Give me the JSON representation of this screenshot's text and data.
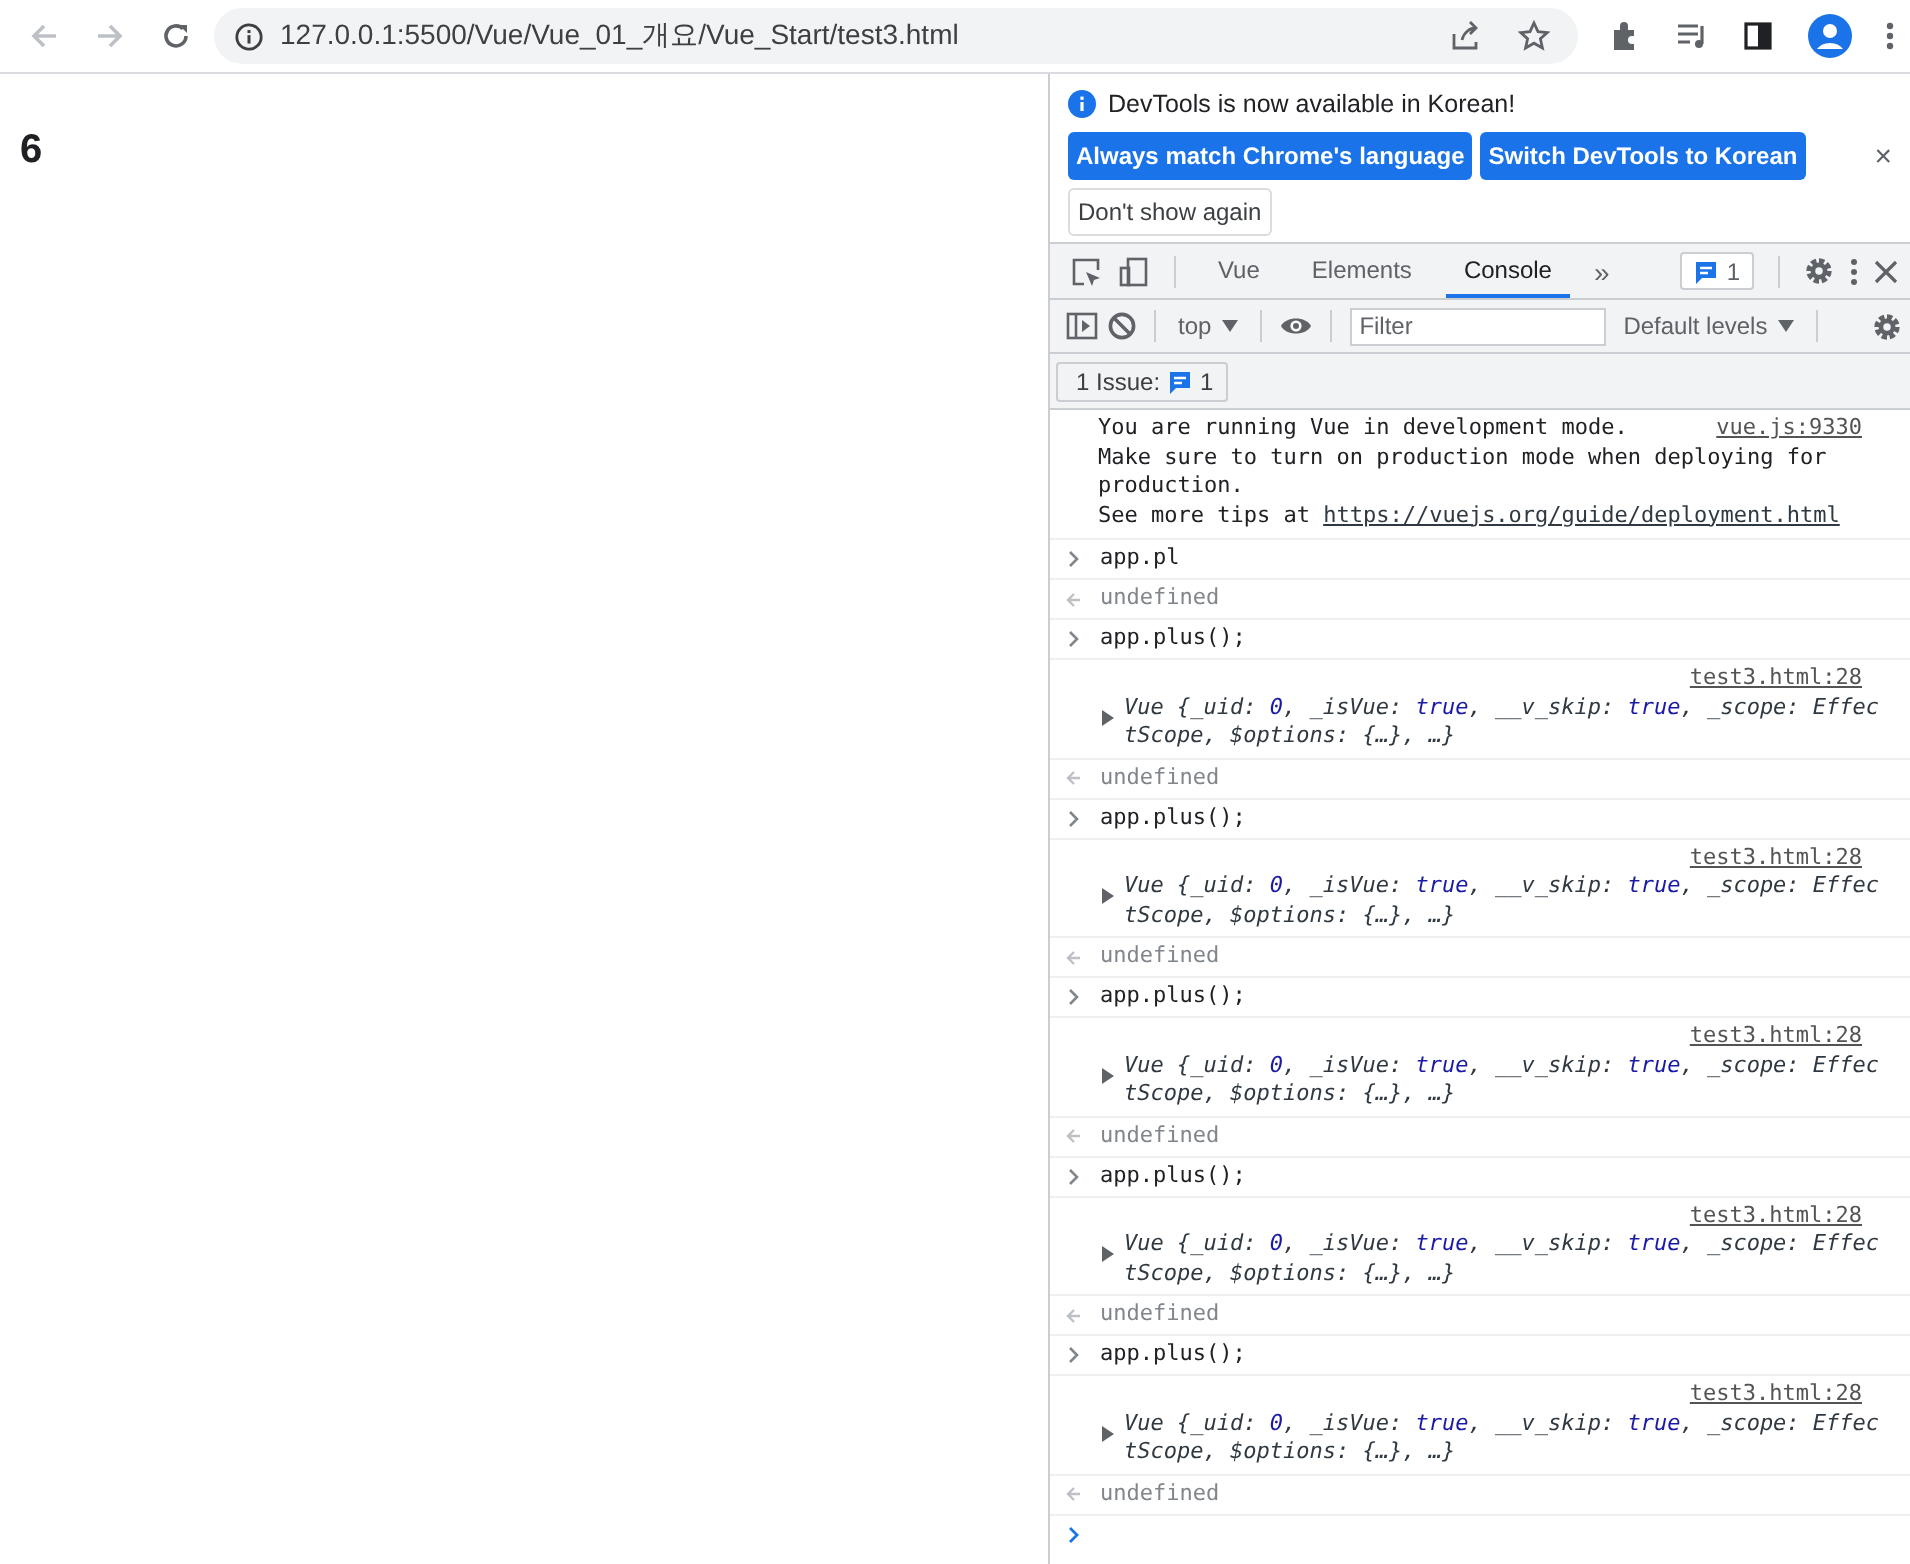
{
  "browser": {
    "url": "127.0.0.1:5500/Vue/Vue_01_개요/Vue_Start/test3.html"
  },
  "page": {
    "heading": "6"
  },
  "devtools": {
    "infobar": {
      "message": "DevTools is now available in Korean!",
      "close": "×",
      "buttons": [
        {
          "label": "Always match Chrome's language",
          "kind": "primary"
        },
        {
          "label": "Switch DevTools to Korean",
          "kind": "primary"
        },
        {
          "label": "Don't show again",
          "kind": "secondary"
        }
      ]
    },
    "tabs": [
      {
        "label": "Vue",
        "selected": false
      },
      {
        "label": "Elements",
        "selected": false
      },
      {
        "label": "Console",
        "selected": true
      }
    ],
    "more": "»",
    "issues_count": "1",
    "console_toolbar": {
      "context": "top",
      "filter_placeholder": "Filter",
      "levels": "Default levels"
    },
    "issues_button": {
      "label": "1 Issue:",
      "count": "1"
    },
    "entries": [
      {
        "kind": "log",
        "source": "vue.js:9330",
        "lines": [
          "You are running Vue in development mode.",
          "Make sure to turn on production mode when deploying for production."
        ],
        "tip": "See more tips at",
        "link": "https://vuejs.org/guide/deployment.html"
      },
      {
        "kind": "input",
        "text": "app.pl"
      },
      {
        "kind": "result",
        "text": "undefined"
      },
      {
        "kind": "input",
        "text": "app.plus();"
      },
      {
        "kind": "object",
        "source": "test3.html:28",
        "parts": [
          {
            "t": "Vue {_uid: ",
            "kind": "plain"
          },
          {
            "t": "0",
            "kind": "value"
          },
          {
            "t": ", _isVue: ",
            "kind": "plain"
          },
          {
            "t": "true",
            "kind": "value"
          },
          {
            "t": ", __v_skip: ",
            "kind": "plain"
          },
          {
            "t": "true",
            "kind": "value"
          },
          {
            "t": ", _scope: EffectScope, $options: {…}, …}",
            "kind": "plain"
          }
        ]
      },
      {
        "kind": "result",
        "text": "undefined"
      },
      {
        "kind": "input",
        "text": "app.plus();"
      },
      {
        "kind": "object",
        "source": "test3.html:28",
        "parts": [
          {
            "t": "Vue {_uid: ",
            "kind": "plain"
          },
          {
            "t": "0",
            "kind": "value"
          },
          {
            "t": ", _isVue: ",
            "kind": "plain"
          },
          {
            "t": "true",
            "kind": "value"
          },
          {
            "t": ", __v_skip: ",
            "kind": "plain"
          },
          {
            "t": "true",
            "kind": "value"
          },
          {
            "t": ", _scope: EffectScope, $options: {…}, …}",
            "kind": "plain"
          }
        ]
      },
      {
        "kind": "result",
        "text": "undefined"
      },
      {
        "kind": "input",
        "text": "app.plus();"
      },
      {
        "kind": "object",
        "source": "test3.html:28",
        "parts": [
          {
            "t": "Vue {_uid: ",
            "kind": "plain"
          },
          {
            "t": "0",
            "kind": "value"
          },
          {
            "t": ", _isVue: ",
            "kind": "plain"
          },
          {
            "t": "true",
            "kind": "value"
          },
          {
            "t": ", __v_skip: ",
            "kind": "plain"
          },
          {
            "t": "true",
            "kind": "value"
          },
          {
            "t": ", _scope: EffectScope, $options: {…}, …}",
            "kind": "plain"
          }
        ]
      },
      {
        "kind": "result",
        "text": "undefined"
      },
      {
        "kind": "input",
        "text": "app.plus();"
      },
      {
        "kind": "object",
        "source": "test3.html:28",
        "parts": [
          {
            "t": "Vue {_uid: ",
            "kind": "plain"
          },
          {
            "t": "0",
            "kind": "value"
          },
          {
            "t": ", _isVue: ",
            "kind": "plain"
          },
          {
            "t": "true",
            "kind": "value"
          },
          {
            "t": ", __v_skip: ",
            "kind": "plain"
          },
          {
            "t": "true",
            "kind": "value"
          },
          {
            "t": ", _scope: EffectScope, $options: {…}, …}",
            "kind": "plain"
          }
        ]
      },
      {
        "kind": "result",
        "text": "undefined"
      },
      {
        "kind": "input",
        "text": "app.plus();"
      },
      {
        "kind": "object",
        "source": "test3.html:28",
        "parts": [
          {
            "t": "Vue {_uid: ",
            "kind": "plain"
          },
          {
            "t": "0",
            "kind": "value"
          },
          {
            "t": ", _isVue: ",
            "kind": "plain"
          },
          {
            "t": "true",
            "kind": "value"
          },
          {
            "t": ", __v_skip: ",
            "kind": "plain"
          },
          {
            "t": "true",
            "kind": "value"
          },
          {
            "t": ", _scope: EffectScope, $options: {…}, …}",
            "kind": "plain"
          }
        ]
      },
      {
        "kind": "result",
        "text": "undefined"
      }
    ]
  }
}
